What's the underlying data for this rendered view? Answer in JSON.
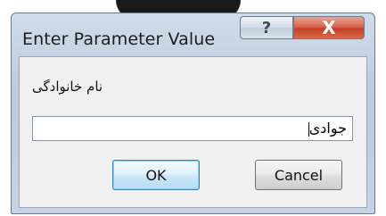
{
  "dialog": {
    "title": "Enter Parameter Value",
    "help_label": "?",
    "close_label": "X",
    "prompt": "نام خانوادگی",
    "input_value": "جوادی",
    "ok_label": "OK",
    "cancel_label": "Cancel"
  },
  "icons": {
    "help": "question-mark-icon",
    "close": "close-icon"
  },
  "colors": {
    "frame": "#c5d3e4",
    "close_button": "#c43e23",
    "ok_border": "#3c7fb1"
  }
}
